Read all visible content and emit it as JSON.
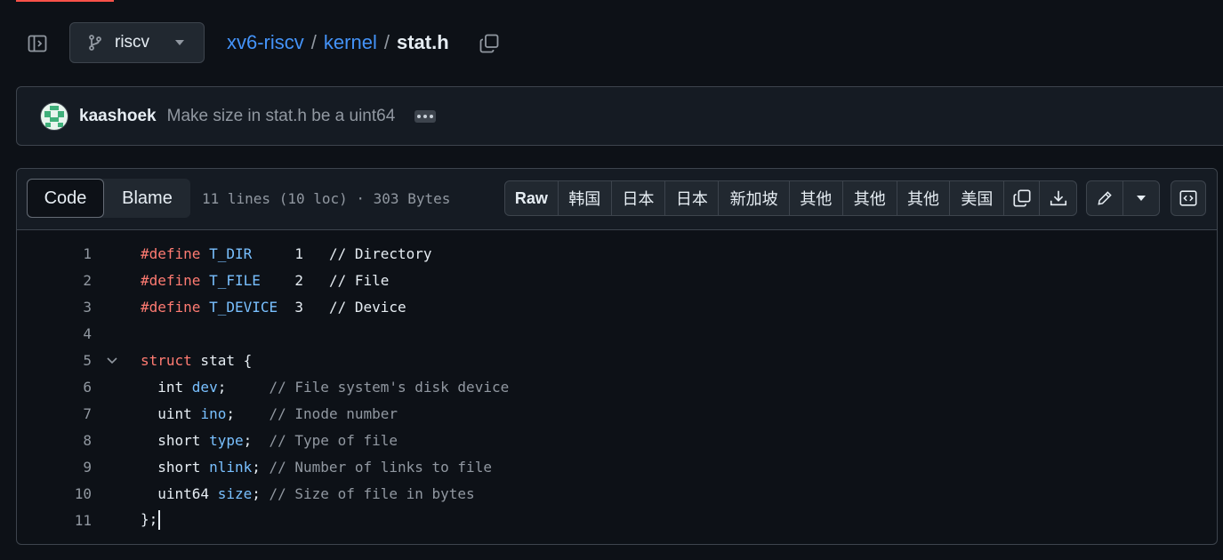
{
  "header": {
    "branch": "riscv",
    "breadcrumb": {
      "repo": "xv6-riscv",
      "sep1": "/",
      "dir": "kernel",
      "sep2": "/",
      "file": "stat.h"
    }
  },
  "commit": {
    "author": "kaashoek",
    "message": "Make size in stat.h be a uint64"
  },
  "viewer": {
    "tabs": {
      "code": "Code",
      "blame": "Blame"
    },
    "meta": "11 lines (10 loc) · 303 Bytes",
    "actions": [
      "Raw",
      "韩国",
      "日本",
      "日本",
      "新加坡",
      "其他",
      "其他",
      "其他",
      "美国"
    ]
  },
  "code": {
    "line_numbers": [
      "1",
      "2",
      "3",
      "4",
      "5",
      "6",
      "7",
      "8",
      "9",
      "10",
      "11"
    ],
    "l1": {
      "kw": "#define",
      "name": "T_DIR",
      "val": "     1   ",
      "cm": "// Directory"
    },
    "l2": {
      "kw": "#define",
      "name": "T_FILE",
      "val": "    2   ",
      "cm": "// File"
    },
    "l3": {
      "kw": "#define",
      "name": "T_DEVICE",
      "val": "  3   ",
      "cm": "// Device"
    },
    "l5": {
      "kw": "struct",
      "rest": " stat {"
    },
    "l6": {
      "type": "  int ",
      "id": "dev",
      "semi": ";     ",
      "cm": "// File system's disk device"
    },
    "l7": {
      "type": "  uint ",
      "id": "ino",
      "semi": ";    ",
      "cm": "// Inode number"
    },
    "l8": {
      "type": "  short ",
      "id": "type",
      "semi": ";  ",
      "cm": "// Type of file"
    },
    "l9": {
      "type": "  short ",
      "id": "nlink",
      "semi": "; ",
      "cm": "// Number of links to file"
    },
    "l10": {
      "type": "  uint64 ",
      "id": "size",
      "semi": "; ",
      "cm": "// Size of file in bytes"
    },
    "l11": {
      "text": "};"
    }
  },
  "icons": [
    "sidebar-toggle-icon",
    "git-branch-icon",
    "copy-icon",
    "download-icon",
    "pencil-icon",
    "chevron-down-icon",
    "code-square-icon",
    "kebab-dots-icon"
  ]
}
